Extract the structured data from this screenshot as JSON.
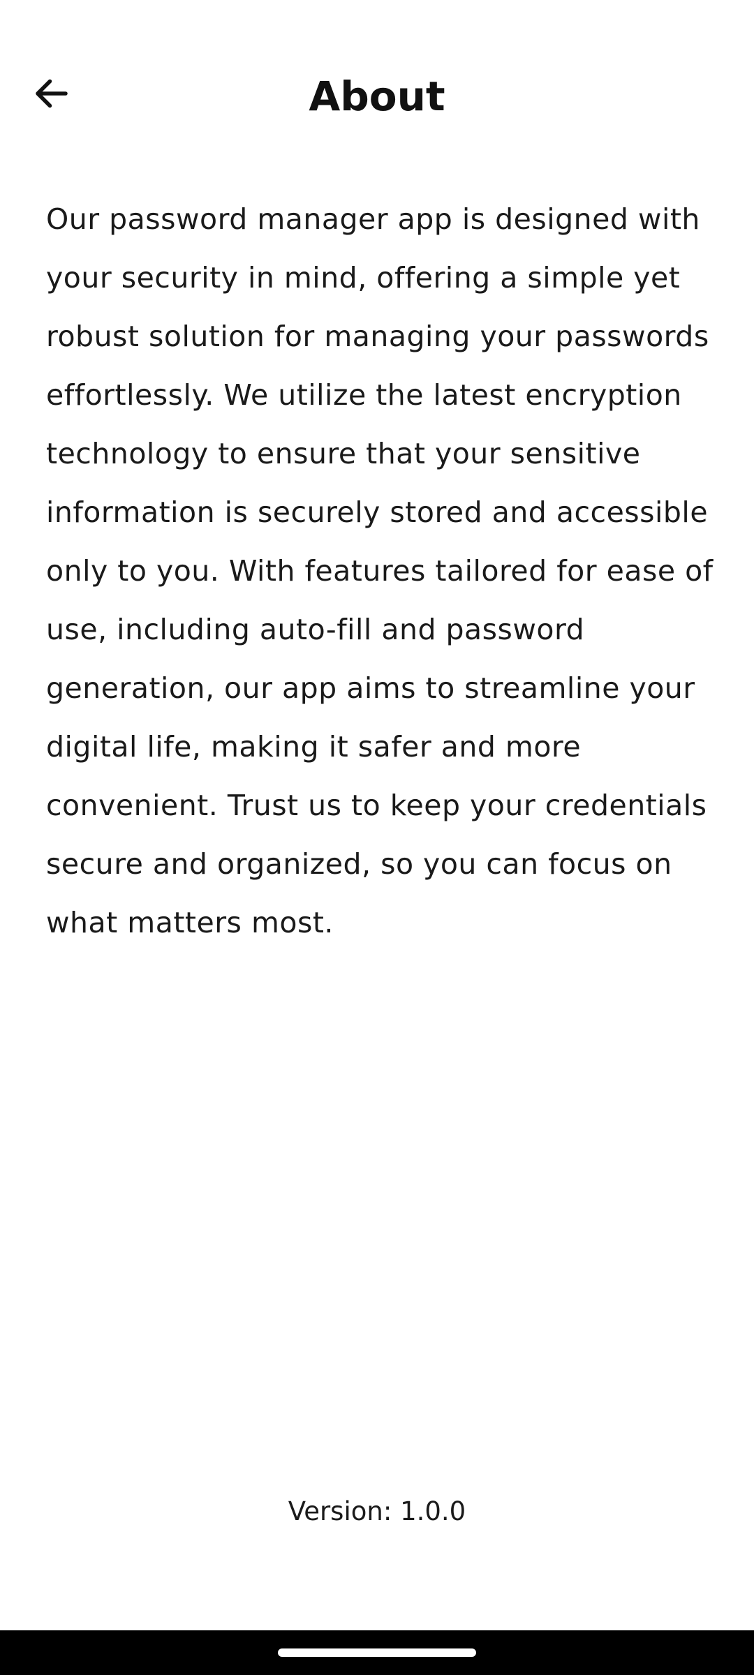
{
  "header": {
    "title": "About",
    "back_icon": "arrow-left-icon"
  },
  "main": {
    "description": "Our password manager app is designed with your security in mind, offering a simple yet robust solution for managing your passwords effortlessly. We utilize the latest encryption technology to ensure that your sensitive information is securely stored and accessible only to you. With features tailored for ease of use, including auto-fill and password generation, our app aims to streamline your digital life, making it safer and more convenient. Trust us to keep your credentials secure and organized, so you can focus on what matters most."
  },
  "footer": {
    "version_label": "Version:",
    "version_value": "1.0.0"
  },
  "colors": {
    "background": "#ffffff",
    "text": "#111111",
    "nav_bar": "#000000"
  }
}
